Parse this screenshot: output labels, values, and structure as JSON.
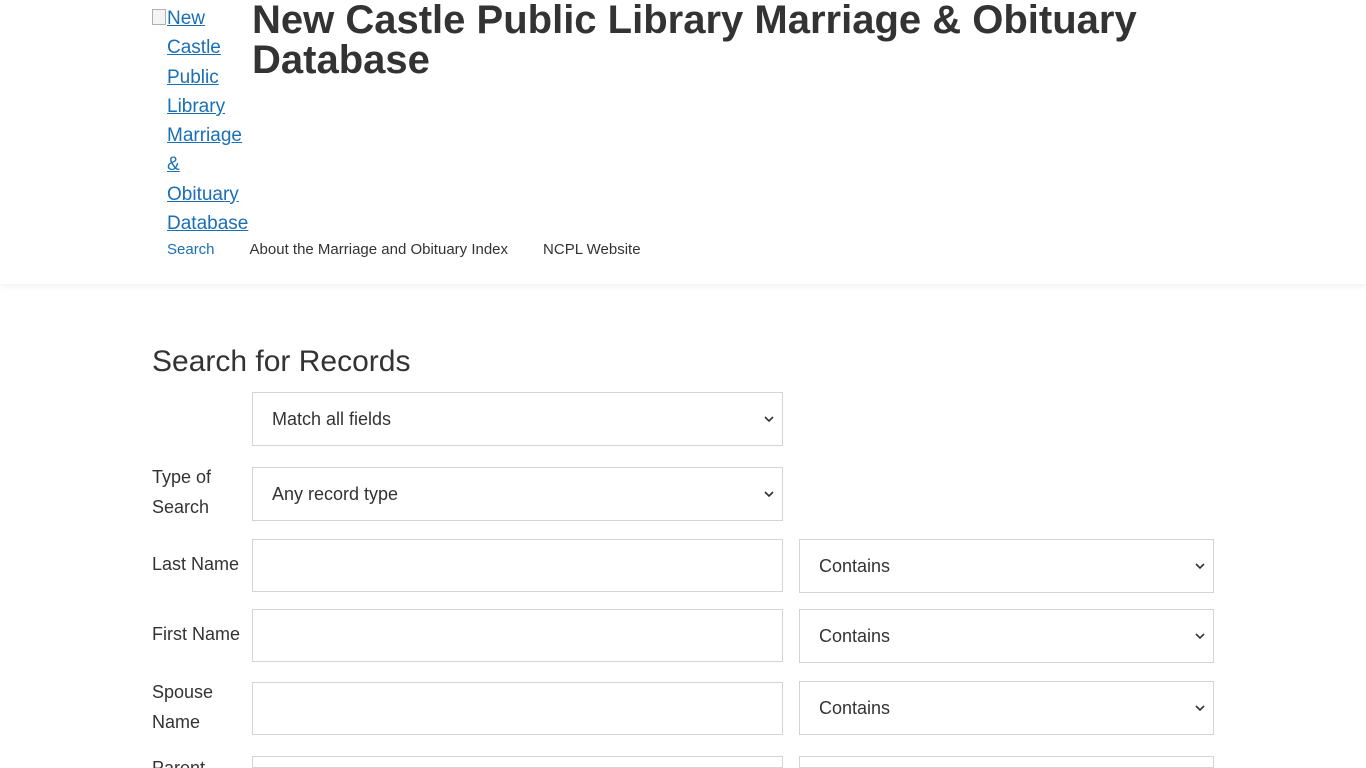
{
  "header": {
    "logo_alt": "New Castle Public Library Marriage & Obituary Database",
    "logo_lines": [
      "New",
      "Castle",
      "Public",
      "Library",
      "Marriage &",
      "Obituary",
      "Database"
    ],
    "title": "New Castle Public Library Marriage & Obituary Database"
  },
  "nav": {
    "items": [
      {
        "label": "Search",
        "active": true
      },
      {
        "label": "About the Marriage and Obituary Index"
      },
      {
        "label": "NCPL Website"
      }
    ]
  },
  "main": {
    "heading": "Search for Records",
    "match_select": {
      "value": "Match all fields"
    },
    "type_row": {
      "label_lines": [
        "Type of",
        "Search"
      ],
      "value": "Any record type"
    },
    "rows": [
      {
        "label_lines": [
          "Last Name"
        ],
        "input_value": "",
        "operator": "Contains"
      },
      {
        "label_lines": [
          "First Name"
        ],
        "input_value": "",
        "operator": "Contains"
      },
      {
        "label_lines": [
          "Spouse",
          "Name"
        ],
        "input_value": "",
        "operator": "Contains"
      },
      {
        "label_lines": [
          "Parent"
        ],
        "input_value": "",
        "operator": ""
      }
    ]
  },
  "icons": {
    "dropdown": "chevron-down-icon",
    "broken_image": "broken-image-icon"
  },
  "colors": {
    "link": "#1a6fb5",
    "text": "#333333",
    "border": "#d4d4d4"
  }
}
